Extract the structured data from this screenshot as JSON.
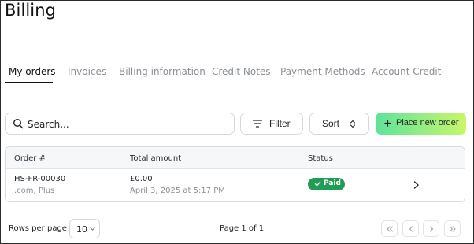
{
  "page": {
    "title": "Billing"
  },
  "tabs": [
    {
      "label": "My orders",
      "active": true
    },
    {
      "label": "Invoices",
      "active": false
    },
    {
      "label": "Billing information",
      "active": false
    },
    {
      "label": "Credit Notes",
      "active": false
    },
    {
      "label": "Payment Methods",
      "active": false
    },
    {
      "label": "Account Credit",
      "active": false
    }
  ],
  "toolbar": {
    "search_placeholder": "Search...",
    "search_icon": "search-icon",
    "filter_label": "Filter",
    "filter_icon": "filter-icon",
    "sort_label": "Sort",
    "sort_icon": "sort-chevrons-icon",
    "place_order_label": "Place new order",
    "place_order_icon": "plus-icon"
  },
  "table": {
    "columns": [
      "Order #",
      "Total amount",
      "Status"
    ],
    "rows": [
      {
        "order_number": "HS-FR-00030",
        "order_detail": ".com, Plus",
        "total": "£0.00",
        "date": "April 3, 2025 at 5:17 PM",
        "status": "Paid",
        "status_icon": "check-icon",
        "row_action_icon": "chevron-right-icon"
      }
    ]
  },
  "pagination": {
    "rows_per_page_label": "Rows per page",
    "rows_per_page_value": "10",
    "page_info": "Page 1 of 1",
    "buttons": [
      "first-page-icon",
      "previous-page-icon",
      "next-page-icon",
      "last-page-icon"
    ]
  },
  "colors": {
    "status_paid": "#1f9d55",
    "accent_gradient_start": "#5ee39a",
    "accent_gradient_end": "#c8f76a",
    "muted_text": "#8a9096"
  }
}
